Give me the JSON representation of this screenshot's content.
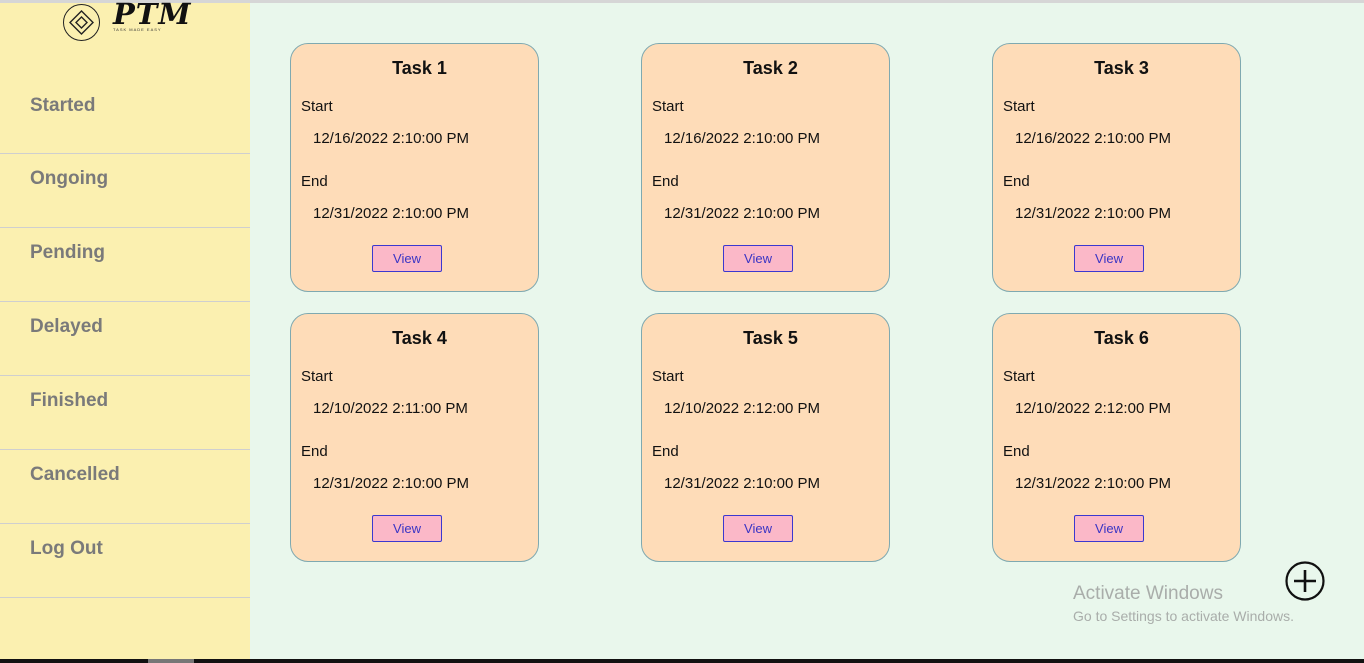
{
  "logo": {
    "text": "PTM",
    "tagline": "TASK MADE EASY"
  },
  "sidebar": {
    "items": [
      {
        "label": "Started"
      },
      {
        "label": "Ongoing"
      },
      {
        "label": "Pending"
      },
      {
        "label": "Delayed"
      },
      {
        "label": "Finished"
      },
      {
        "label": "Cancelled"
      },
      {
        "label": "Log Out"
      }
    ]
  },
  "tasks": [
    {
      "title": "Task 1",
      "start_label": "Start",
      "start": "12/16/2022 2:10:00 PM",
      "end_label": "End",
      "end": "12/31/2022 2:10:00 PM",
      "button": "View"
    },
    {
      "title": "Task 2",
      "start_label": "Start",
      "start": "12/16/2022 2:10:00 PM",
      "end_label": "End",
      "end": "12/31/2022 2:10:00 PM",
      "button": "View"
    },
    {
      "title": "Task 3",
      "start_label": "Start",
      "start": "12/16/2022 2:10:00 PM",
      "end_label": "End",
      "end": "12/31/2022 2:10:00 PM",
      "button": "View"
    },
    {
      "title": "Task 4",
      "start_label": "Start",
      "start": "12/10/2022 2:11:00 PM",
      "end_label": "End",
      "end": "12/31/2022 2:10:00 PM",
      "button": "View"
    },
    {
      "title": "Task 5",
      "start_label": "Start",
      "start": "12/10/2022 2:12:00 PM",
      "end_label": "End",
      "end": "12/31/2022 2:10:00 PM",
      "button": "View"
    },
    {
      "title": "Task 6",
      "start_label": "Start",
      "start": "12/10/2022 2:12:00 PM",
      "end_label": "End",
      "end": "12/31/2022 2:10:00 PM",
      "button": "View"
    }
  ],
  "add_button": {
    "icon": "plus-circle-icon"
  },
  "watermark": {
    "title": "Activate Windows",
    "subtitle": "Go to Settings to activate Windows."
  },
  "colors": {
    "background": "#e9f7ec",
    "sidebar": "#fbf0b0",
    "card": "#fedcb8",
    "view_button": "#fbb8c8",
    "view_button_text": "#3a34c4"
  }
}
